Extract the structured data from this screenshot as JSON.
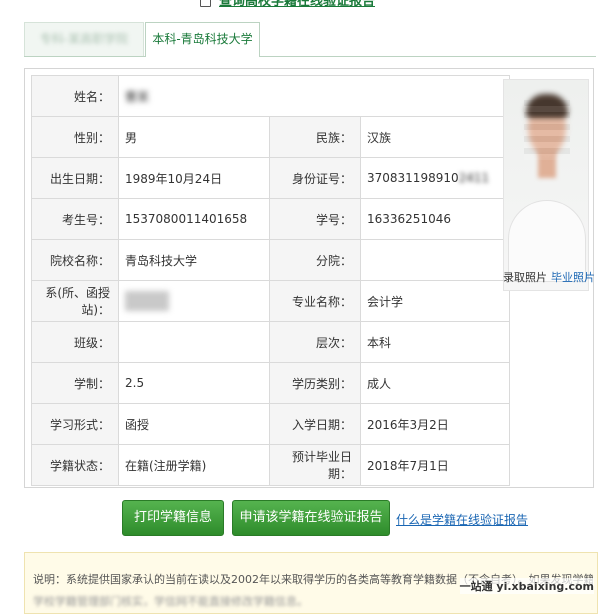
{
  "header": {
    "title": "查询高校学籍在线验证报告"
  },
  "tabs": [
    {
      "label": "专科-某高职学院"
    },
    {
      "label": "本科-青岛科技大学"
    }
  ],
  "info_rows": [
    {
      "label1": "姓名：",
      "value1": "曹某"
    },
    {
      "label1": "性别：",
      "value1": "男",
      "label2": "民族：",
      "value2": "汉族"
    },
    {
      "label1": "出生日期：",
      "value1": "1989年10月24日",
      "label2": "身份证号：",
      "value2": "370831198910",
      "value2_tail": "2411"
    },
    {
      "label1": "考生号：",
      "value1": "15370800114016​58",
      "label2": "学号：",
      "value2": "16336251046"
    },
    {
      "label1": "院校名称：",
      "value1": "青岛科技大学",
      "label2": "分院：",
      "value2": ""
    },
    {
      "label1": "系(所、函授站)：",
      "value1": "",
      "label2": "专业名称：",
      "value2": "会计学"
    },
    {
      "label1": "班级：",
      "value1": "",
      "label2": "层次：",
      "value2": "本科"
    },
    {
      "label1": "学制：",
      "value1": "2.5",
      "label2": "学历类别：",
      "value2": "成人"
    },
    {
      "label1": "学习形式：",
      "value1": "函授",
      "label2": "入学日期：",
      "value2": "2016年3月2日"
    },
    {
      "label1": "学籍状态：",
      "value1": "在籍(注册学籍)",
      "label2": "预计毕业日期：",
      "value2": "2018年7月1日"
    }
  ],
  "photo": {
    "caption_a": "录取照片",
    "caption_b": "毕业照片"
  },
  "buttons": {
    "print": "打印学籍信息",
    "apply": "申请该学籍在线验证报告"
  },
  "help_link": "什么是学籍在线验证报告",
  "note": {
    "text": "说明：系统提供国家承认的当前在读以及2002年以来取得学历的各类高等教育学籍数据（不含自考）。如果发现学籍信息有误，请联系",
    "line2": "学校学籍管理部门核实，学信网不能直接修改学籍信息。"
  },
  "watermark": "一站通 yi.xbaixing.com",
  "colors": {
    "accent": "#1a7a3a",
    "button": "#3a9a36",
    "link": "#1a66b3"
  }
}
